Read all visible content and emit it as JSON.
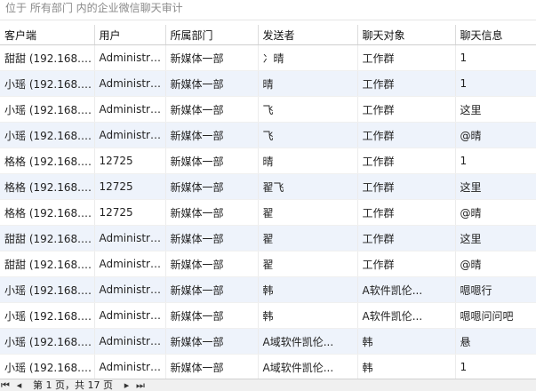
{
  "location_bar": {
    "text": "位于 所有部门 内的企业微信聊天审计"
  },
  "table": {
    "headers": [
      "客户端",
      "用户",
      "所属部门",
      "发送者",
      "聊天对象",
      "聊天信息"
    ],
    "rows": [
      [
        "甜甜 (192.168.1...",
        "Administra...",
        "新媒体一部",
        "冫晴",
        "工作群",
        "1"
      ],
      [
        "小瑶 (192.168.1...",
        "Administra...",
        "新媒体一部",
        "晴",
        "工作群",
        "1"
      ],
      [
        "小瑶 (192.168.1...",
        "Administra...",
        "新媒体一部",
        "飞",
        "工作群",
        "这里"
      ],
      [
        "小瑶 (192.168.1...",
        "Administra...",
        "新媒体一部",
        "飞",
        "工作群",
        "@晴"
      ],
      [
        "格格 (192.168.1...",
        "12725",
        "新媒体一部",
        "晴",
        "工作群",
        "1"
      ],
      [
        "格格 (192.168.1...",
        "12725",
        "新媒体一部",
        "翟飞",
        "工作群",
        "这里"
      ],
      [
        "格格 (192.168.1...",
        "12725",
        "新媒体一部",
        "翟",
        "工作群",
        "@晴"
      ],
      [
        "甜甜 (192.168.1...",
        "Administra...",
        "新媒体一部",
        "翟",
        "工作群",
        "这里"
      ],
      [
        "甜甜 (192.168.1...",
        "Administra...",
        "新媒体一部",
        "翟",
        "工作群",
        "@晴"
      ],
      [
        "小瑶 (192.168.1...",
        "Administra...",
        "新媒体一部",
        "韩",
        "A软件凯伦...",
        "嗯嗯行"
      ],
      [
        "小瑶 (192.168.1...",
        "Administra...",
        "新媒体一部",
        "韩",
        "A软件凯伦...",
        "嗯嗯问问吧"
      ],
      [
        "小瑶 (192.168.1...",
        "Administra...",
        "新媒体一部",
        "A域软件凯伦...",
        "韩",
        "悬"
      ],
      [
        "小瑶 (192.168.1...",
        "Administra...",
        "新媒体一部",
        "A域软件凯伦...",
        "韩",
        "1"
      ]
    ]
  },
  "pager": {
    "first_icon": "first-page-icon",
    "prev_icon": "prev-page-icon",
    "next_icon": "next-page-icon",
    "last_icon": "last-page-icon",
    "first_glyph": "⏮",
    "prev_glyph": "◂",
    "next_glyph": "▸",
    "last_glyph": "⏭",
    "page_text": "第 1 页，共 17 页"
  },
  "colors": {
    "alt_row": "#eef3fb",
    "location_text": "#8a8a8a"
  }
}
